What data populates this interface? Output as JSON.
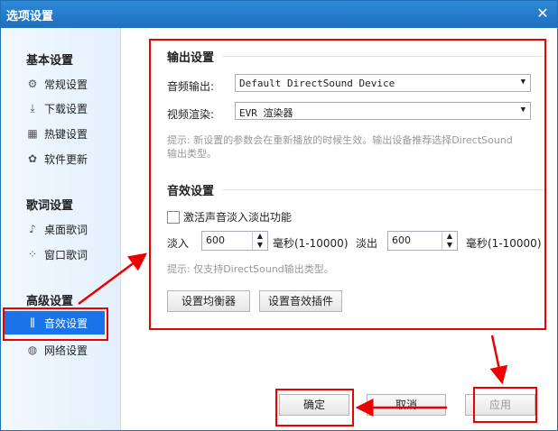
{
  "window": {
    "title": "选项设置"
  },
  "sidebar": {
    "sections": [
      {
        "title": "基本设置",
        "items": [
          {
            "label": "常规设置",
            "icon": "gear-icon"
          },
          {
            "label": "下载设置",
            "icon": "download-icon"
          },
          {
            "label": "热键设置",
            "icon": "keyboard-icon"
          },
          {
            "label": "软件更新",
            "icon": "update-icon"
          }
        ]
      },
      {
        "title": "歌词设置",
        "items": [
          {
            "label": "桌面歌词",
            "icon": "desktop-lyrics-icon"
          },
          {
            "label": "窗口歌词",
            "icon": "window-lyrics-icon"
          }
        ]
      },
      {
        "title": "高级设置",
        "items": [
          {
            "label": "音效设置",
            "icon": "equalizer-icon",
            "selected": true
          },
          {
            "label": "网络设置",
            "icon": "network-icon"
          }
        ]
      }
    ]
  },
  "output": {
    "title": "输出设置",
    "audio_label": "音频输出:",
    "audio_value": "Default DirectSound Device",
    "video_label": "视频渲染:",
    "video_value": "EVR 渲染器",
    "hint_line1": "提示: 新设置的参数会在重新播放的时候生效。输出设备推荐选择DirectSound",
    "hint_line2": "输出类型。"
  },
  "effects": {
    "title": "音效设置",
    "fade_checkbox_label": "激活声音淡入淡出功能",
    "fade_checked": false,
    "fade_in_label": "淡入",
    "fade_in_value": "600",
    "fade_out_label": "淡出",
    "fade_out_value": "600",
    "unit_label": "毫秒(1-10000)",
    "hint": "提示: 仅支持DirectSound输出类型。",
    "equalizer_button": "设置均衡器",
    "plugin_button": "设置音效插件"
  },
  "footer": {
    "ok": "确定",
    "cancel": "取消",
    "apply": "应用"
  },
  "annotation_color": "#e00000"
}
